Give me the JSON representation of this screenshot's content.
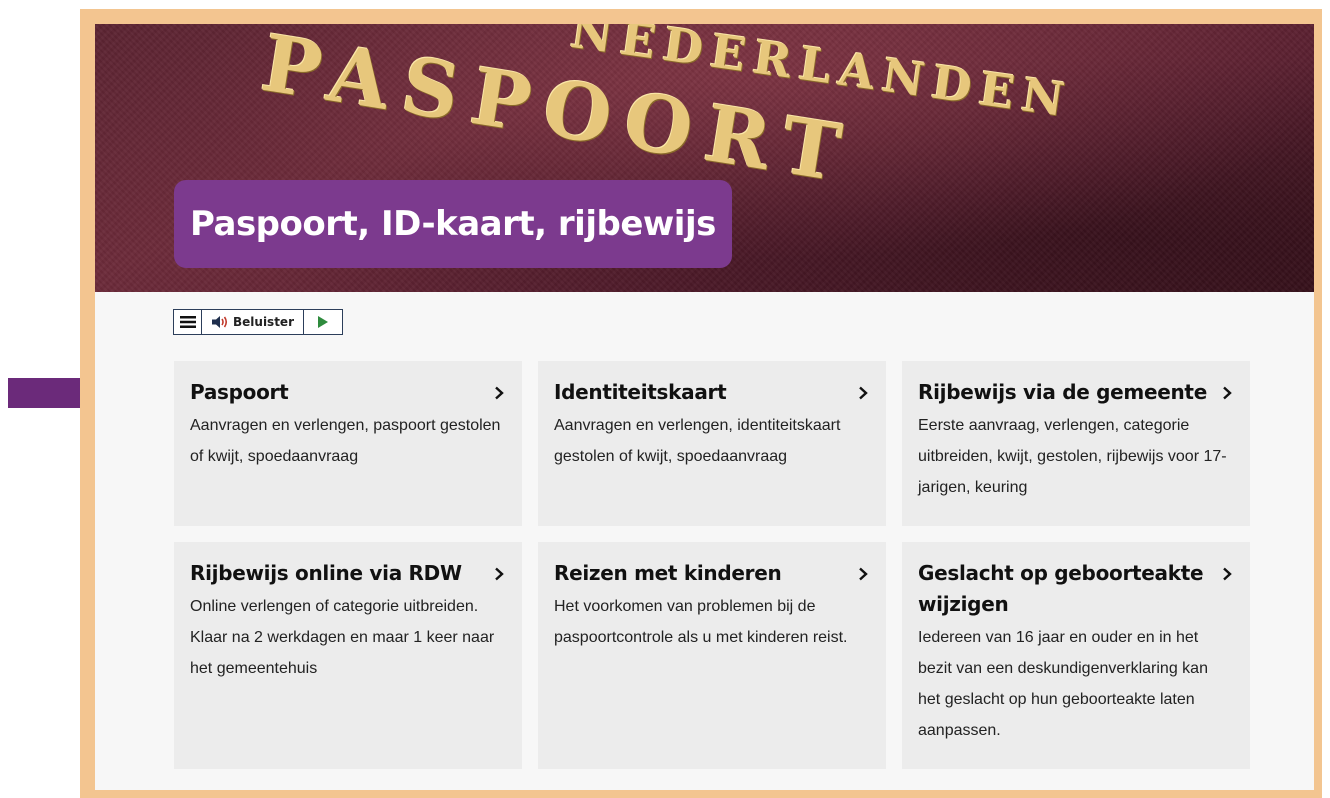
{
  "hero": {
    "title": "Paspoort, ID-kaart, rijbewijs",
    "emboss_country": "NEDERLANDEN",
    "emboss_word": "PASPOORT"
  },
  "toolbar": {
    "menu_icon": "hamburger-menu-icon",
    "speaker_icon": "speaker-icon",
    "listen_label": "Beluister",
    "play_icon": "play-icon"
  },
  "cards": [
    {
      "title": "Paspoort",
      "description": "Aanvragen en verlengen, paspoort gestolen of kwijt, spoedaanvraag"
    },
    {
      "title": "Identiteitskaart",
      "description": "Aanvragen en verlengen, identiteitskaart gestolen of kwijt, spoedaanvraag"
    },
    {
      "title": "Rijbewijs via de gemeente",
      "description": "Eerste aanvraag, verlengen, categorie uitbreiden, kwijt, gestolen, rijbewijs voor 17-jarigen, keuring"
    },
    {
      "title": "Rijbewijs online via RDW",
      "description": "Online verlengen of categorie uitbreiden. Klaar na 2 werkdagen en maar 1 keer naar het gemeentehuis"
    },
    {
      "title": "Reizen met kinderen",
      "description": "Het voorkomen van problemen bij de paspoortcontrole als u met kinderen reist."
    },
    {
      "title": "Geslacht op geboorteakte wijzigen",
      "description": "Iedereen van 16 jaar en ouder en in het bezit van een deskundigenverklaring kan het geslacht op hun geboorteakte laten aanpassen."
    }
  ],
  "colors": {
    "frame": "#f3c590",
    "title_background": "#7c3a8e",
    "arrow": "#6b2a7a",
    "card_background": "#ececec",
    "play_green": "#2e8b3d"
  }
}
